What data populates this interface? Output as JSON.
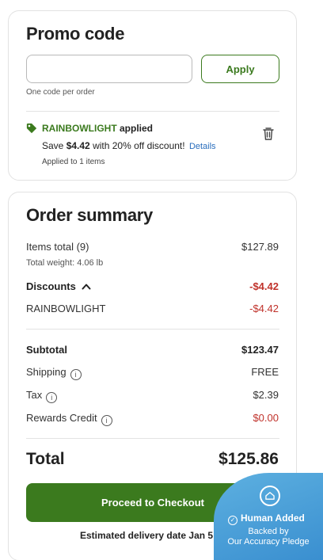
{
  "promo": {
    "title": "Promo code",
    "input_value": "",
    "input_placeholder": "",
    "apply_label": "Apply",
    "hint": "One code per order",
    "applied_code": "RAINBOWLIGHT",
    "applied_suffix": "applied",
    "save_prefix": "Save",
    "save_amount": "$4.42",
    "save_suffix": "with 20% off discount!",
    "details_label": "Details",
    "applied_to": "Applied to 1 items"
  },
  "summary": {
    "title": "Order summary",
    "items_label": "Items total (9)",
    "items_value": "$127.89",
    "weight_label": "Total weight: 4.06 lb",
    "discounts_label": "Discounts",
    "discounts_value": "-$4.42",
    "discount_code_label": "RAINBOWLIGHT",
    "discount_code_value": "-$4.42",
    "subtotal_label": "Subtotal",
    "subtotal_value": "$123.47",
    "shipping_label": "Shipping",
    "shipping_value": "FREE",
    "tax_label": "Tax",
    "tax_value": "$2.39",
    "rewards_label": "Rewards Credit",
    "rewards_value": "$0.00",
    "total_label": "Total",
    "total_value": "$125.86",
    "checkout_label": "Proceed to Checkout",
    "delivery_text": "Estimated delivery date Jan 5 - 6"
  },
  "badge": {
    "title": "Human Added",
    "line1": "Backed by",
    "line2": "Our Accuracy Pledge"
  },
  "colors": {
    "brand_green": "#3b7a1e",
    "discount_red": "#c0322b",
    "link_blue": "#2a6ebd",
    "badge_blue": "#3a8fd0"
  },
  "icons": {
    "tag": "tag-icon",
    "trash": "trash-icon",
    "info": "info-icon",
    "chevron": "chevron-up-icon",
    "badge": "shield-house-icon",
    "check": "check-circle-icon"
  }
}
